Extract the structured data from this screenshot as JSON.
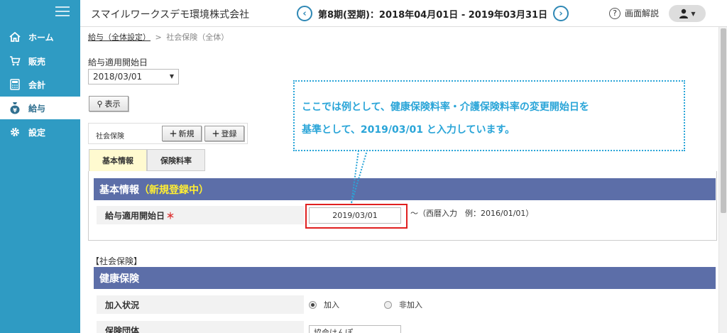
{
  "sidebar": {
    "items": [
      {
        "label": "ホーム",
        "icon": "home-icon"
      },
      {
        "label": "販売",
        "icon": "cart-icon"
      },
      {
        "label": "会計",
        "icon": "calculator-icon"
      },
      {
        "label": "給与",
        "icon": "moneybag-icon"
      },
      {
        "label": "設定",
        "icon": "gear-icon"
      }
    ],
    "active_index": 3
  },
  "header": {
    "company": "スマイルワークスデモ環境株式会社",
    "period": "第8期(翌期)：2018年04月01日 - 2019年03月31日",
    "help": "画面解説"
  },
  "breadcrumb": {
    "link": "給与（全体設定）",
    "sep": ">",
    "current": "社会保険（全体）"
  },
  "filter": {
    "label": "給与適用開始日",
    "selected": "2018/03/01",
    "show_button": "表示"
  },
  "shakai": {
    "label": "社会保険",
    "new_button": "新規",
    "register_button": "登録"
  },
  "tabs": [
    {
      "label": "基本情報"
    },
    {
      "label": "保険料率"
    }
  ],
  "basic": {
    "title": "基本情報",
    "status": "（新規登録中）",
    "date_label": "給与適用開始日",
    "required_mark": "＊",
    "date_value": "2019/03/01",
    "hint": "〜（西暦入力　例：2016/01/01）"
  },
  "callout": {
    "line1": "ここでは例として、健康保険料率・介護保険料率の変更開始日を",
    "line2": "基準として、2019/03/01 と入力しています。"
  },
  "social": {
    "heading": "【社会保険】",
    "health_title": "健康保険",
    "status_label": "加入状況",
    "option_join": "加入",
    "option_nonjoin": "非加入",
    "union_label": "保険団体",
    "union_value": "協会けんぽ"
  }
}
